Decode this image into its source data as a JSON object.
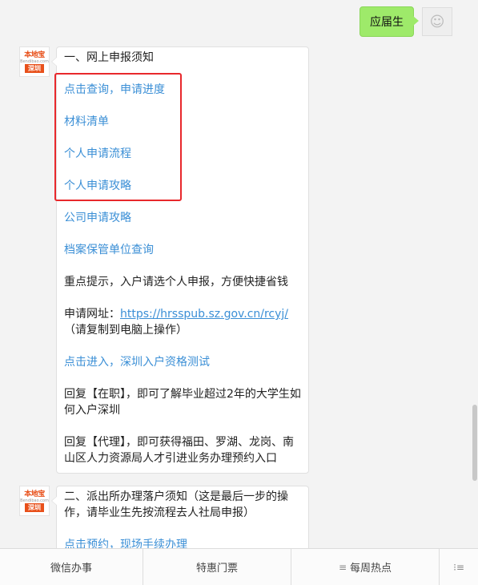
{
  "outgoing": {
    "text": "应届生"
  },
  "bot_logo": {
    "top": "本地宝",
    "middle": "Bendibao.com",
    "bottom": "深圳"
  },
  "message1": {
    "heading": "一、网上申报须知",
    "link_query": "点击查询，申请进度",
    "link_materials": "材料清单",
    "link_process": "个人申请流程",
    "link_guide": "个人申请攻略",
    "link_company": "公司申请攻略",
    "link_archive": "档案保管单位查询",
    "tip": "重点提示，入户请选个人申报，方便快捷省钱",
    "url_label": "申请网址：",
    "url": "https://hrsspub.sz.gov.cn/rcyj/",
    "url_note": "（请复制到电脑上操作）",
    "link_test": "点击进入，深圳入户资格测试",
    "reply1": "回复【在职】，即可了解毕业超过2年的大学生如何入户深圳",
    "reply2": "回复【代理】，即可获得福田、罗湖、龙岗、南山区人力资源局人才引进业务办理预约入口"
  },
  "message2": {
    "heading": "二、派出所办理落户须知（这是最后一步的操作，请毕业生先按流程去人社局申报）",
    "link_partial": "点击预约，现场手续办理"
  },
  "bottom_menu": {
    "item1": "微信办事",
    "item2": "特惠门票",
    "item3": "每周热点",
    "menu_icon": "≡",
    "keyboard_icon": "⁝≡"
  },
  "colors": {
    "link": "#3b8fd6",
    "bubble_green": "#9eea6a",
    "highlight": "#e8282c",
    "brand": "#e8501a"
  }
}
